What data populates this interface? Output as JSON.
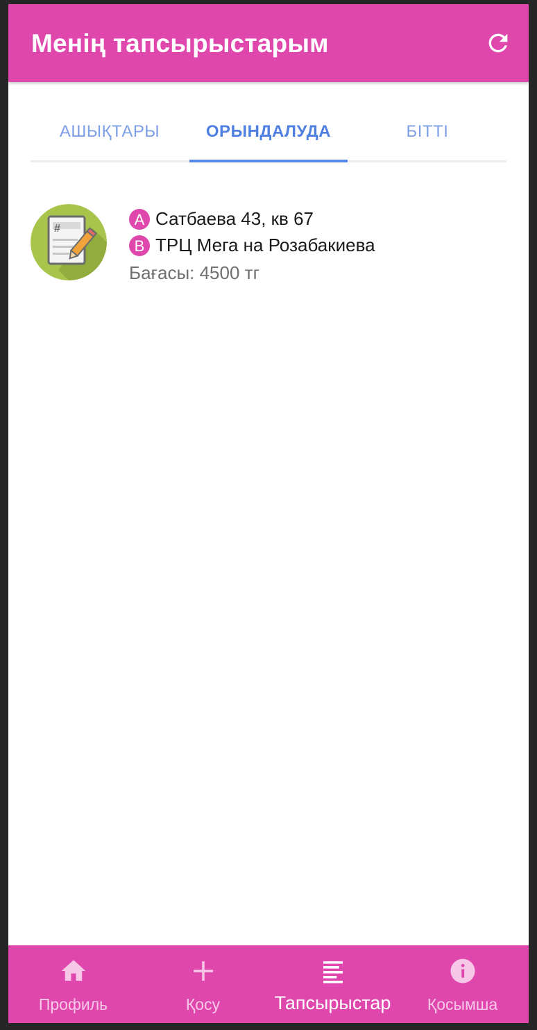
{
  "header": {
    "title": "Менің тапсырыстарым",
    "refresh_icon": "refresh-icon"
  },
  "tabs": [
    {
      "label": "АШЫҚТАРЫ",
      "active": false
    },
    {
      "label": "ОРЫНДАЛУДА",
      "active": true
    },
    {
      "label": "БІТТІ",
      "active": false
    }
  ],
  "orders": [
    {
      "icon": "document-edit-icon",
      "from_marker": "A",
      "from": "Сатбаева 43, кв 67",
      "to_marker": "B",
      "to": "ТРЦ Мега на Розабакиева",
      "price": "Бағасы: 4500 тг"
    }
  ],
  "bottom_nav": [
    {
      "label": "Профиль",
      "icon": "home-icon",
      "active": false
    },
    {
      "label": "Қосу",
      "icon": "plus-icon",
      "active": false
    },
    {
      "label": "Тапсырыстар",
      "icon": "list-icon",
      "active": true
    },
    {
      "label": "Қосымша",
      "icon": "info-icon",
      "active": false
    }
  ],
  "colors": {
    "primary": "#e047ad",
    "tab_active": "#4f7fe0",
    "tab_inactive": "#7d9fe6",
    "icon_bg": "#a8c44a"
  }
}
